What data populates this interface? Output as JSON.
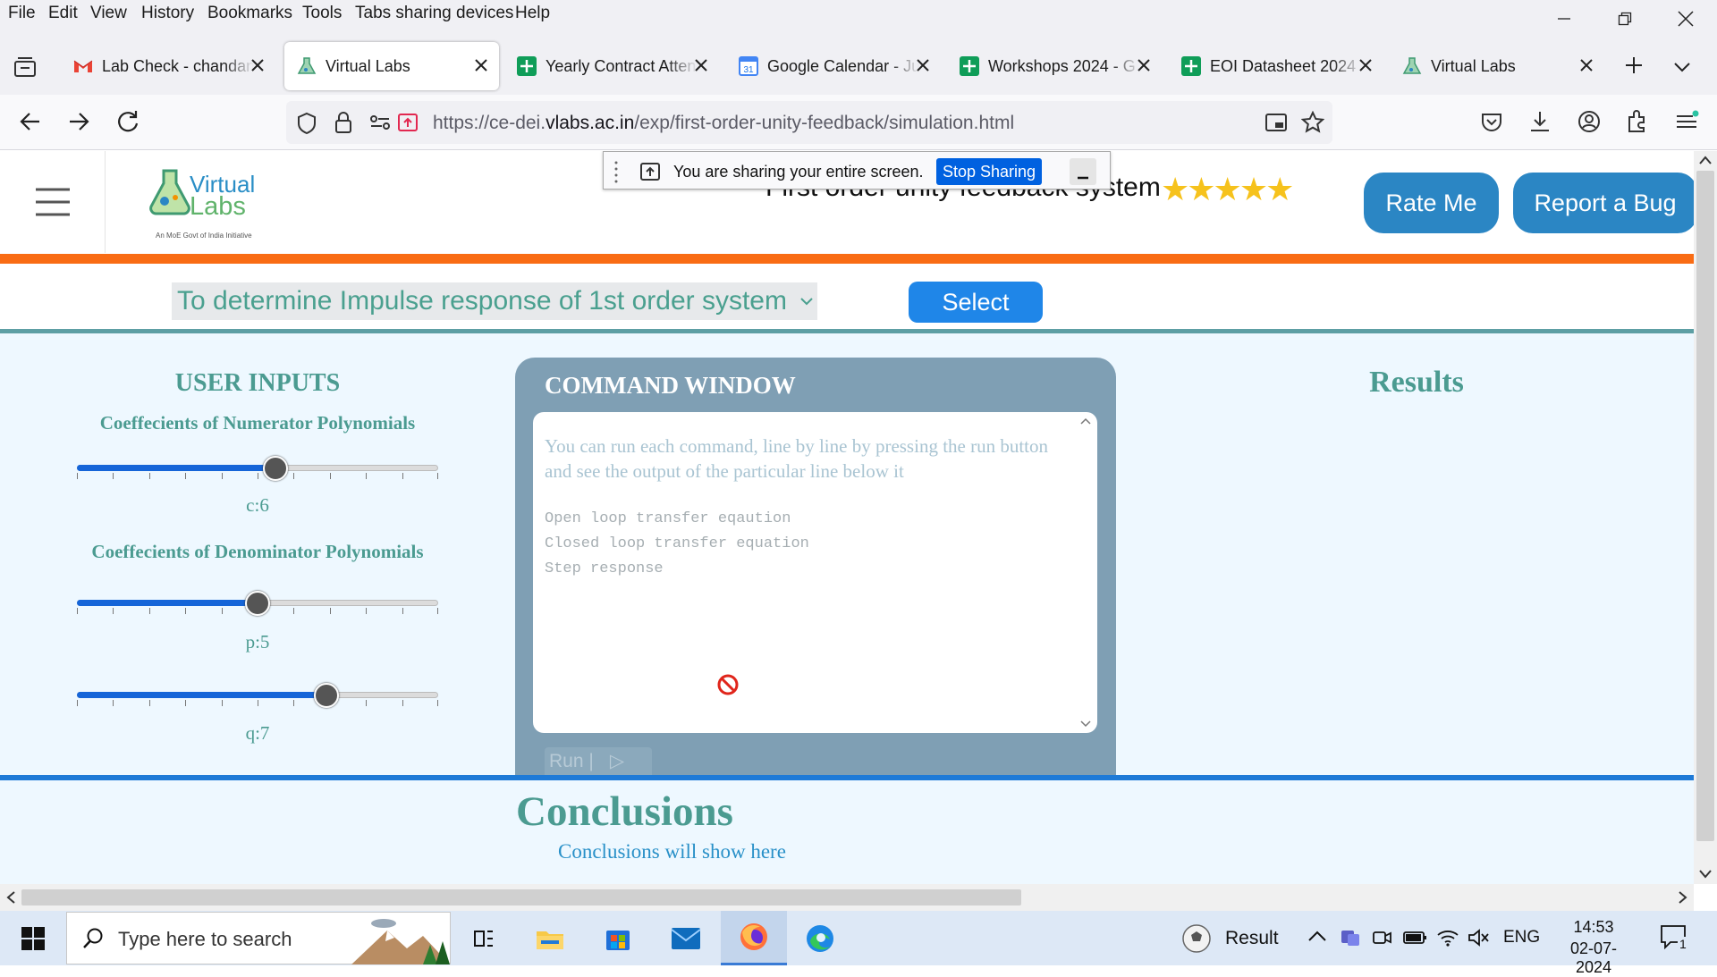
{
  "menubar": {
    "items": [
      "File",
      "Edit",
      "View",
      "History",
      "Bookmarks",
      "Tools",
      "Tabs sharing devices",
      "Help"
    ]
  },
  "tabs": [
    {
      "label": "Lab Check - chandana",
      "icon": "gmail-icon",
      "active": false
    },
    {
      "label": "Virtual Labs",
      "icon": "virtual-labs-icon",
      "active": true
    },
    {
      "label": "Yearly Contract Attendance",
      "icon": "sheets-icon",
      "active": false
    },
    {
      "label": "Google Calendar - July",
      "icon": "calendar-icon",
      "active": false
    },
    {
      "label": "Workshops 2024 - G",
      "icon": "sheets-icon",
      "active": false
    },
    {
      "label": "EOI Datasheet 2024",
      "icon": "sheets-icon",
      "active": false
    },
    {
      "label": "Virtual Labs",
      "icon": "virtual-labs-icon",
      "active": false
    }
  ],
  "address": {
    "prefix": "https://ce-dei.",
    "domain": "vlabs.ac.in",
    "path": "/exp/first-order-unity-feedback/simulation.html"
  },
  "sharing": {
    "message": "You are sharing your entire screen.",
    "stop_label": "Stop Sharing"
  },
  "header": {
    "logo_line1": "Virtual",
    "logo_line2": "Labs",
    "logo_tagline": "An MoE Govt of India Initiative",
    "title": "First order unity feedback system",
    "stars": "★★★★★",
    "rate_label": "Rate Me",
    "bug_label": "Report a Bug"
  },
  "experiment": {
    "selected": "To determine Impulse response of 1st order system",
    "select_label": "Select"
  },
  "inputs": {
    "heading": "USER INPUTS",
    "numerator_heading": "Coeffecients of Numerator Polynomials",
    "denominator_heading": "Coeffecients of Denominator Polynomials",
    "sliders": [
      {
        "label": "c:6",
        "fraction": 0.55
      },
      {
        "label": "p:5",
        "fraction": 0.5
      },
      {
        "label": "q:7",
        "fraction": 0.69
      }
    ]
  },
  "command": {
    "title": "COMMAND WINDOW",
    "hint": "You can run each command, line by line by pressing the run button and see the output of the particular line below it",
    "lines": [
      "Open loop transfer eqaution",
      "Closed loop transfer equation",
      "Step response"
    ],
    "run_label": "Run |",
    "run_symbol": "▷"
  },
  "results": {
    "heading": "Results"
  },
  "conclusions": {
    "heading": "Conclusions",
    "text": "Conclusions will show here"
  },
  "taskbar": {
    "search_placeholder": "Type here to search",
    "weather_label": "Result",
    "language": "ENG",
    "time": "14:53",
    "date": "02-07-2024",
    "notification_count": "1"
  },
  "colors": {
    "accent_blue": "#2b86c4",
    "orange_bar": "#f96c14",
    "teal_text": "#4b9b91",
    "command_bg": "#7f9fb4",
    "star": "#f6c21c"
  }
}
